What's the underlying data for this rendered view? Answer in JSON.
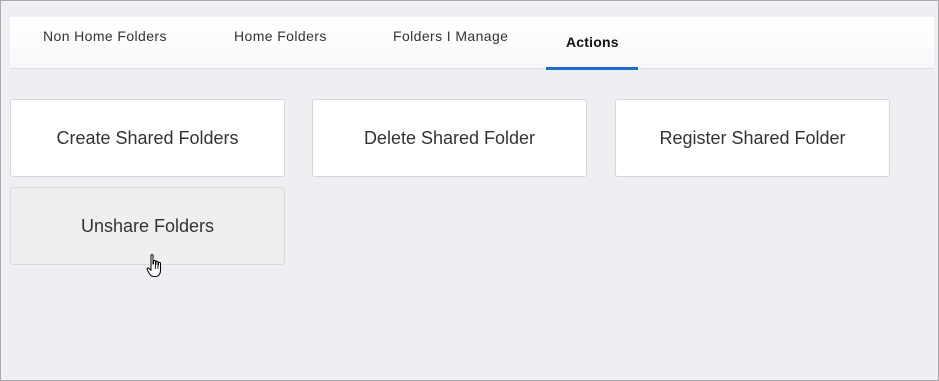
{
  "tabs": [
    {
      "label": "Non Home Folders",
      "active": false
    },
    {
      "label": "Home Folders",
      "active": false
    },
    {
      "label": "Folders I Manage",
      "active": false
    },
    {
      "label": "Actions",
      "active": true
    }
  ],
  "actions": {
    "create": "Create Shared Folders",
    "delete": "Delete Shared Folder",
    "register": "Register Shared Folder",
    "unshare": "Unshare Folders"
  },
  "colors": {
    "accent": "#1e6fd0",
    "background": "#eeeff3",
    "card": "#ffffff",
    "card_hover": "#efeff0"
  },
  "cursor_icon": "hand-pointer-icon"
}
